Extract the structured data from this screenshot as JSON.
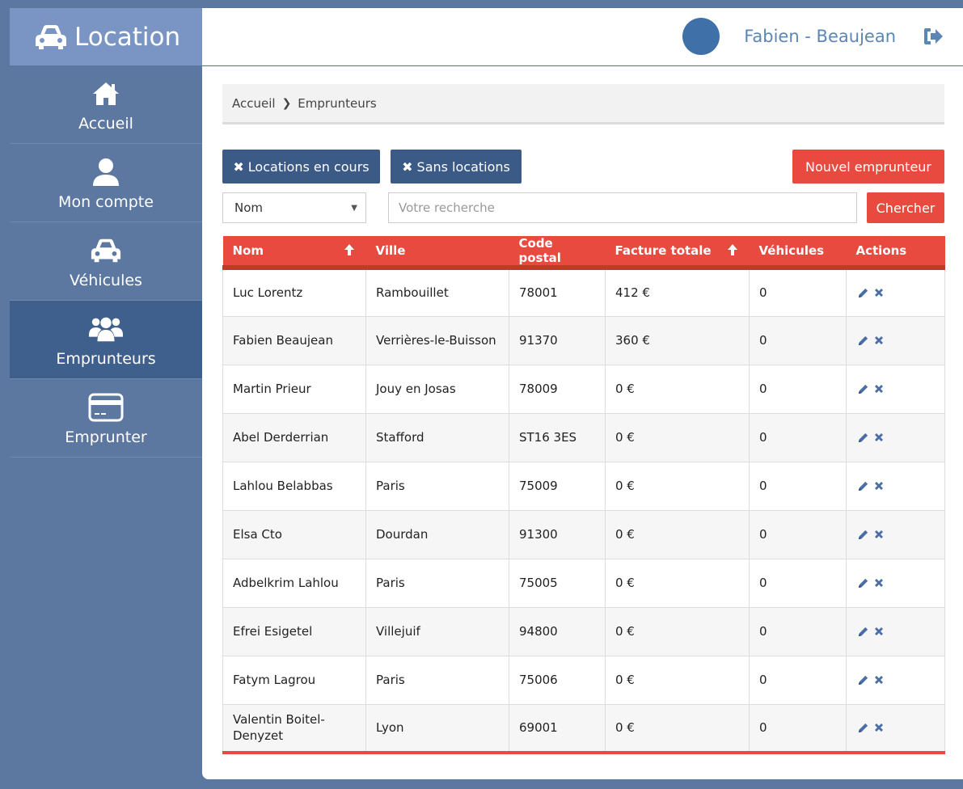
{
  "app": {
    "title": "Location"
  },
  "sidebar": {
    "items": [
      {
        "label": "Accueil",
        "icon": "home-icon"
      },
      {
        "label": "Mon compte",
        "icon": "user-icon"
      },
      {
        "label": "Véhicules",
        "icon": "car-icon"
      },
      {
        "label": "Emprunteurs",
        "icon": "users-icon",
        "active": true
      },
      {
        "label": "Emprunter",
        "icon": "credit-card-icon"
      }
    ]
  },
  "header": {
    "user_name": "Fabien - Beaujean",
    "logout_icon": "sign-out-icon"
  },
  "breadcrumb": {
    "home": "Accueil",
    "current": "Emprunteurs"
  },
  "filters": {
    "locations_en_cours": "Locations en cours",
    "sans_locations": "Sans locations",
    "nouvel_emprunteur": "Nouvel emprunteur",
    "select_value": "Nom",
    "search_placeholder": "Votre recherche",
    "search_button": "Chercher"
  },
  "table": {
    "columns": [
      "Nom",
      "Ville",
      "Code postal",
      "Facture totale",
      "Véhicules",
      "Actions"
    ],
    "rows": [
      [
        "Luc Lorentz",
        "Rambouillet",
        "78001",
        "412 €",
        "0"
      ],
      [
        "Fabien Beaujean",
        "Verrières-le-Buisson",
        "91370",
        "360 €",
        "0"
      ],
      [
        "Martin Prieur",
        "Jouy en Josas",
        "78009",
        "0 €",
        "0"
      ],
      [
        "Abel Derderrian",
        "Stafford",
        "ST16 3ES",
        "0 €",
        "0"
      ],
      [
        "Lahlou Belabbas",
        "Paris",
        "75009",
        "0 €",
        "0"
      ],
      [
        "Elsa Cto",
        "Dourdan",
        "91300",
        "0 €",
        "0"
      ],
      [
        "Adbelkrim Lahlou",
        "Paris",
        "75005",
        "0 €",
        "0"
      ],
      [
        "Efrei Esigetel",
        "Villejuif",
        "94800",
        "0 €",
        "0"
      ],
      [
        "Fatym Lagrou",
        "Paris",
        "75006",
        "0 €",
        "0"
      ],
      [
        "Valentin Boitel-Denyzet",
        "Lyon",
        "69001",
        "0 €",
        "0"
      ]
    ]
  },
  "colors": {
    "sidebar": "#5c77a0",
    "brand": "#7a95c4",
    "active": "#3f5f8c",
    "accent_red": "#e84a3f",
    "button_blue": "#3c5a86"
  }
}
